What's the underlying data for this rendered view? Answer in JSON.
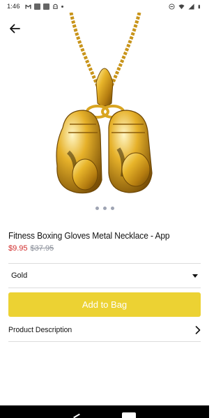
{
  "status_bar": {
    "time": "1:46"
  },
  "product": {
    "title": "Fitness Boxing Gloves Metal Necklace - App",
    "price": "$9.95",
    "original_price": "$37.95",
    "image_icon": "boxing-gloves-necklace-image",
    "carousel_count": 3
  },
  "variant": {
    "selected": "Gold"
  },
  "actions": {
    "add_to_bag": "Add to Bag",
    "product_description": "Product Description"
  },
  "colors": {
    "accent": "#ecd233",
    "price": "#d12c2c",
    "original_price": "#8a8f99",
    "divider": "#dcdcdc"
  }
}
